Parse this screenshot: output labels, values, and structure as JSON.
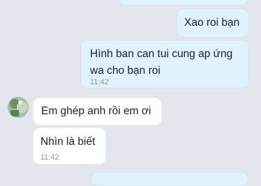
{
  "chat": {
    "messages": [
      {
        "direction": "out",
        "text": "Xao roi bạn"
      },
      {
        "direction": "out",
        "text_line1": "Hình ban can tui cung ap ứng",
        "text_line2": "wa cho bạn roi",
        "time": "11:42"
      },
      {
        "direction": "in",
        "text": "Em ghép anh rồi em ơi"
      },
      {
        "direction": "in",
        "text": "Nhìn là biết",
        "time": "11:42"
      }
    ]
  },
  "colors": {
    "background": "#e3e6ec",
    "outgoing_bubble": "#dff2fd",
    "incoming_bubble": "#ffffff",
    "timestamp": "#8a96a3"
  },
  "icons": {
    "sender_avatar": "avatar-photo"
  }
}
